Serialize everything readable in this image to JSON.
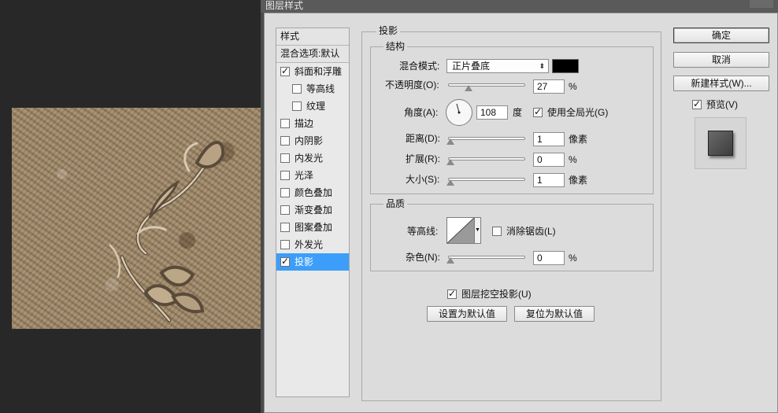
{
  "dialog": {
    "title": "图层样式"
  },
  "styles": {
    "header": "样式",
    "blend_options": "混合选项:默认",
    "items": [
      {
        "label": "斜面和浮雕",
        "checked": true
      },
      {
        "label": "等高线",
        "checked": false
      },
      {
        "label": "纹理",
        "checked": false
      },
      {
        "label": "描边",
        "checked": false
      },
      {
        "label": "内阴影",
        "checked": false
      },
      {
        "label": "内发光",
        "checked": false
      },
      {
        "label": "光泽",
        "checked": false
      },
      {
        "label": "颜色叠加",
        "checked": false
      },
      {
        "label": "渐变叠加",
        "checked": false
      },
      {
        "label": "图案叠加",
        "checked": false
      },
      {
        "label": "外发光",
        "checked": false
      },
      {
        "label": "投影",
        "checked": true
      }
    ]
  },
  "drop_shadow": {
    "title": "投影",
    "structure": {
      "title": "结构",
      "blend_mode_label": "混合模式:",
      "blend_mode_value": "正片叠底",
      "shadow_color": "#000000",
      "opacity_label": "不透明度(O):",
      "opacity_value": "27",
      "opacity_level": 0.27,
      "opacity_unit": "%",
      "angle_label": "角度(A):",
      "angle_value": "108",
      "angle_unit": "度",
      "global_light_label": "使用全局光(G)",
      "global_light_checked": true,
      "distance_label": "距离(D):",
      "distance_value": "1",
      "distance_unit": "像素",
      "spread_label": "扩展(R):",
      "spread_value": "0",
      "spread_unit": "%",
      "size_label": "大小(S):",
      "size_value": "1",
      "size_unit": "像素"
    },
    "quality": {
      "title": "品质",
      "contour_label": "等高线:",
      "anti_alias_label": "消除锯齿(L)",
      "anti_alias_checked": false,
      "noise_label": "杂色(N):",
      "noise_value": "0",
      "noise_unit": "%"
    },
    "knockout_label": "图层挖空投影(U)",
    "knockout_checked": true,
    "make_default": "设置为默认值",
    "reset_default": "复位为默认值"
  },
  "buttons": {
    "ok": "确定",
    "cancel": "取消",
    "new_style": "新建样式(W)...",
    "preview_label": "预览(V)",
    "preview_checked": true
  }
}
